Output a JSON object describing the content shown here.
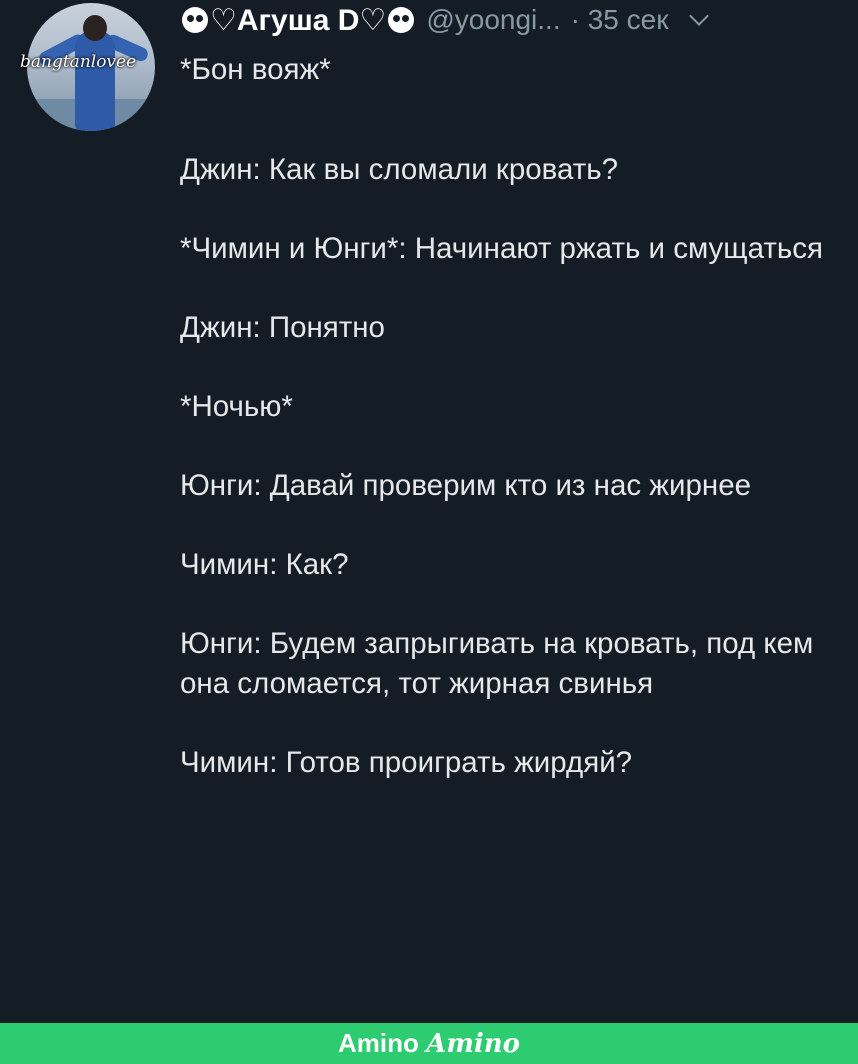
{
  "tweet": {
    "avatar_watermark": "bangtanlovee",
    "author_name": "♡Агуша D♡",
    "handle": "@yoongi...",
    "time": "· 35 сек",
    "menu_icon": "chevron-down-icon",
    "lines": [
      "*Бон вояж*",
      "Джин: Как вы сломали кровать?",
      "*Чимин и Юнги*: Начинают ржать и смущаться",
      "Джин: Понятно",
      "*Ночью*",
      "Юнги: Давай проверим кто из нас жирнее",
      "Чимин: Как?",
      "Юнги: Будем запрыгивать на кровать, под кем она сломается, тот жирная свинья",
      "Чимин: Готов проиграть жирдяй?"
    ]
  },
  "footer": {
    "brand": "Amino",
    "logo_text": "Amino",
    "color": "#2ecc71"
  },
  "colors": {
    "background": "#141d26",
    "secondary_text": "#8899a6"
  }
}
